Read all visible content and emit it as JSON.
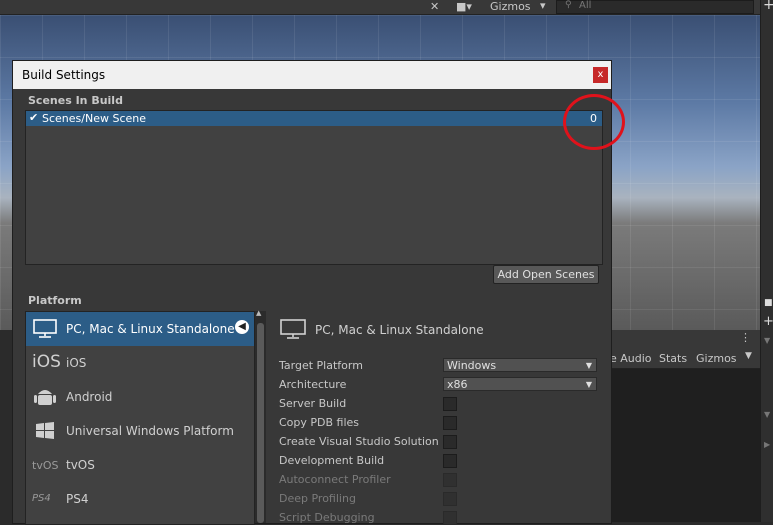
{
  "scene_toolbar": {
    "gizmos": "Gizmos",
    "search_placeholder": "All"
  },
  "game_toolbar": {
    "audio": "e Audio",
    "stats": "Stats",
    "gizmos": "Gizmos"
  },
  "window": {
    "title": "Build Settings",
    "close_label": "x",
    "scenes_header": "Scenes In Build",
    "scenes": [
      {
        "name": "Scenes/New Scene",
        "checked": true,
        "index": "0"
      }
    ],
    "add_open_scenes_label": "Add Open Scenes",
    "platform_header": "Platform",
    "platforms": [
      {
        "label": "PC, Mac & Linux Standalone",
        "icon": "monitor-icon",
        "selected": true
      },
      {
        "label": "iOS",
        "icon": "ios-icon",
        "selected": false
      },
      {
        "label": "Android",
        "icon": "android-icon",
        "selected": false
      },
      {
        "label": "Universal Windows Platform",
        "icon": "windows-icon",
        "selected": false
      },
      {
        "label": "tvOS",
        "icon": "tvos-icon",
        "selected": false
      },
      {
        "label": "PS4",
        "icon": "ps4-icon",
        "selected": false
      }
    ],
    "detail": {
      "title": "PC, Mac & Linux Standalone",
      "target_platform_label": "Target Platform",
      "target_platform_value": "Windows",
      "architecture_label": "Architecture",
      "architecture_value": "x86",
      "options": [
        {
          "label": "Server Build",
          "enabled": true
        },
        {
          "label": "Copy PDB files",
          "enabled": true
        },
        {
          "label": "Create Visual Studio Solution",
          "enabled": true
        },
        {
          "label": "Development Build",
          "enabled": true
        },
        {
          "label": "Autoconnect Profiler",
          "enabled": false
        },
        {
          "label": "Deep Profiling",
          "enabled": false
        },
        {
          "label": "Script Debugging",
          "enabled": false
        }
      ]
    }
  },
  "colors": {
    "selection": "#2c5d87",
    "annotation": "#e0121b",
    "close": "#c62828"
  }
}
